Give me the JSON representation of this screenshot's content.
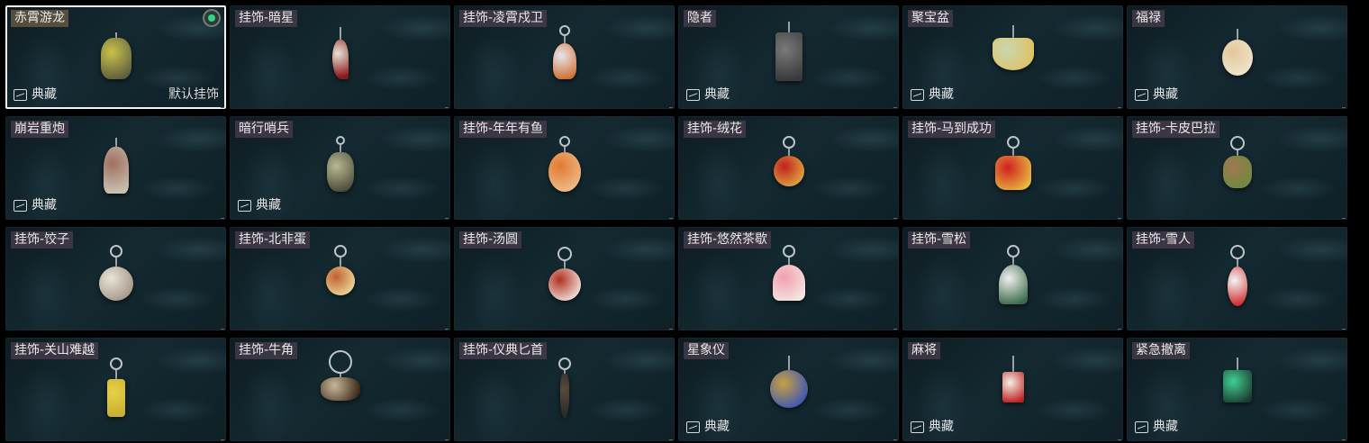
{
  "items": [
    {
      "name": "赤霄游龙",
      "tag": "典藏",
      "default_label": "默认挂饰",
      "selected": true,
      "equipped": true,
      "icon": "dragon-charm-icon",
      "colors": [
        "#c9c24a",
        "#5b5b3e"
      ]
    },
    {
      "name": "挂饰-暗星",
      "tag": "",
      "icon": "dark-star-charm-icon",
      "colors": [
        "#e8e2d4",
        "#8a1a1a"
      ]
    },
    {
      "name": "挂饰-凌霄戍卫",
      "tag": "",
      "icon": "rocket-charm-icon",
      "colors": [
        "#e6e6f0",
        "#d07030"
      ]
    },
    {
      "name": "隐者",
      "tag": "典藏",
      "icon": "hermit-charm-icon",
      "colors": [
        "#7a7a7a",
        "#3a3a3a"
      ]
    },
    {
      "name": "聚宝盆",
      "tag": "典藏",
      "icon": "treasure-bowl-charm-icon",
      "colors": [
        "#c8d8b0",
        "#e0c060"
      ]
    },
    {
      "name": "福禄",
      "tag": "典藏",
      "icon": "gourd-charm-icon",
      "colors": [
        "#e2c89a",
        "#f0e6d0"
      ]
    },
    {
      "name": "崩岩重炮",
      "tag": "典藏",
      "icon": "cannon-charm-icon",
      "colors": [
        "#a07060",
        "#c8c0b0"
      ]
    },
    {
      "name": "暗行哨兵",
      "tag": "典藏",
      "icon": "sentinel-charm-icon",
      "colors": [
        "#b8b890",
        "#4a4a3a"
      ]
    },
    {
      "name": "挂饰-年年有鱼",
      "tag": "",
      "icon": "fish-charm-icon",
      "colors": [
        "#e07a30",
        "#f0c090"
      ]
    },
    {
      "name": "挂饰-绒花",
      "tag": "",
      "icon": "flower-charm-icon",
      "colors": [
        "#c02020",
        "#e0b040"
      ]
    },
    {
      "name": "挂饰-马到成功",
      "tag": "",
      "icon": "horse-charm-icon",
      "colors": [
        "#d02020",
        "#e8c040"
      ]
    },
    {
      "name": "挂饰-卡皮巴拉",
      "tag": "",
      "icon": "capybara-charm-icon",
      "colors": [
        "#a07850",
        "#6a8a40"
      ]
    },
    {
      "name": "挂饰-饺子",
      "tag": "",
      "icon": "dumpling-charm-icon",
      "colors": [
        "#e8e4d8",
        "#a09080"
      ]
    },
    {
      "name": "挂饰-北非蛋",
      "tag": "",
      "icon": "shakshuka-charm-icon",
      "colors": [
        "#c06030",
        "#f0e0a0"
      ]
    },
    {
      "name": "挂饰-汤圆",
      "tag": "",
      "icon": "tangyuan-charm-icon",
      "colors": [
        "#b03020",
        "#f4f0ea"
      ]
    },
    {
      "name": "挂饰-悠然茶歇",
      "tag": "",
      "icon": "cupcake-charm-icon",
      "colors": [
        "#f0a0b0",
        "#f6e6e0"
      ]
    },
    {
      "name": "挂饰-雪松",
      "tag": "",
      "icon": "cedar-charm-icon",
      "colors": [
        "#f0f0f0",
        "#3a6a4a"
      ]
    },
    {
      "name": "挂饰-雪人",
      "tag": "",
      "icon": "snowman-charm-icon",
      "colors": [
        "#f4f4f4",
        "#d03030"
      ]
    },
    {
      "name": "挂饰-关山难越",
      "tag": "",
      "icon": "scroll-charm-icon",
      "colors": [
        "#e8d048",
        "#c8b030"
      ]
    },
    {
      "name": "挂饰-牛角",
      "tag": "",
      "icon": "horn-charm-icon",
      "colors": [
        "#c8b898",
        "#3a2a1a"
      ]
    },
    {
      "name": "挂饰-仪典匕首",
      "tag": "",
      "icon": "dagger-charm-icon",
      "colors": [
        "#5a4a3a",
        "#2a2a2a"
      ]
    },
    {
      "name": "星象仪",
      "tag": "典藏",
      "icon": "astrolabe-charm-icon",
      "colors": [
        "#c8a040",
        "#3050c0"
      ]
    },
    {
      "name": "麻将",
      "tag": "典藏",
      "icon": "mahjong-charm-icon",
      "colors": [
        "#f4f0e6",
        "#c02020"
      ]
    },
    {
      "name": "紧急撤离",
      "tag": "典藏",
      "icon": "evac-sign-charm-icon",
      "colors": [
        "#40d090",
        "#1a3a30"
      ]
    }
  ]
}
